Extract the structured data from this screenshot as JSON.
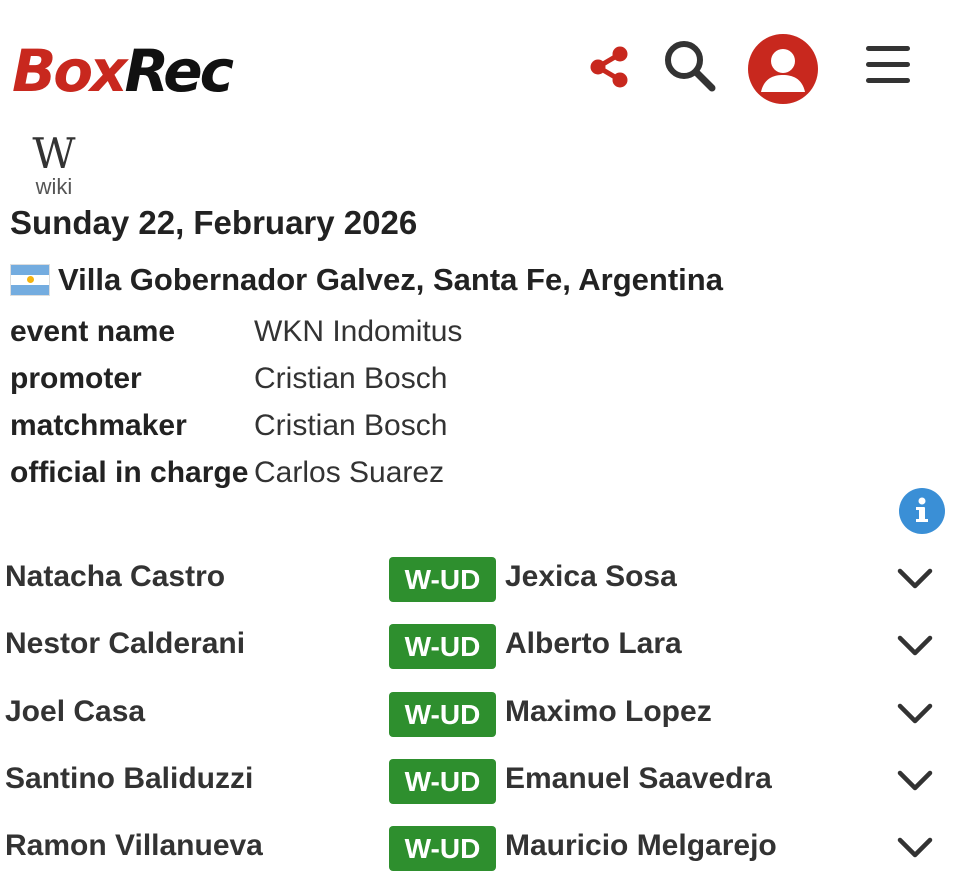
{
  "header": {
    "logo_part1": "Box",
    "logo_part2": "Rec",
    "icons": [
      "share-icon",
      "search-icon",
      "user-avatar-icon",
      "hamburger-menu-icon"
    ],
    "brand_color": "#c8281e"
  },
  "wiki": {
    "glyph": "W",
    "label": "wiki"
  },
  "event": {
    "date": "Sunday 22, February 2026",
    "location": "Villa Gobernador Galvez, Santa Fe, Argentina",
    "details": [
      {
        "key": "event name",
        "value": "WKN Indomitus"
      },
      {
        "key": "promoter",
        "value": "Cristian Bosch"
      },
      {
        "key": "matchmaker",
        "value": "Cristian Bosch"
      },
      {
        "key": "official in charge",
        "value": "Carlos Suarez"
      }
    ]
  },
  "bouts": [
    {
      "winner": "Natacha Castro",
      "result": "W-UD",
      "loser": "Jexica Sosa"
    },
    {
      "winner": "Nestor Calderani",
      "result": "W-UD",
      "loser": "Alberto Lara"
    },
    {
      "winner": "Joel Casa",
      "result": "W-UD",
      "loser": "Maximo Lopez"
    },
    {
      "winner": "Santino Baliduzzi",
      "result": "W-UD",
      "loser": "Emanuel Saavedra"
    },
    {
      "winner": "Ramon Villanueva",
      "result": "W-UD",
      "loser": "Mauricio Melgarejo"
    }
  ],
  "colors": {
    "result_badge": "#2e8f2e",
    "info_icon": "#3a8fd6"
  }
}
